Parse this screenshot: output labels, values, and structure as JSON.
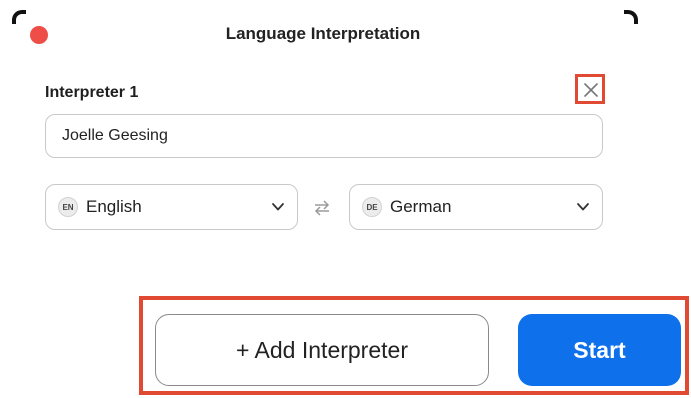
{
  "dialog": {
    "title": "Language Interpretation"
  },
  "interpreter": {
    "label": "Interpreter 1",
    "name": "Joelle Geesing",
    "from_language": {
      "code": "EN",
      "name": "English"
    },
    "to_language": {
      "code": "DE",
      "name": "German"
    }
  },
  "buttons": {
    "add_interpreter": "+ Add Interpreter",
    "start": "Start"
  },
  "icons": {
    "window_close": "close-dot-icon",
    "remove": "close-icon",
    "swap": "swap-arrows-icon",
    "dropdown": "chevron-down-icon"
  },
  "colors": {
    "accent": "#0e71eb",
    "highlight": "#e04a33",
    "window_close": "#ee4d48"
  }
}
